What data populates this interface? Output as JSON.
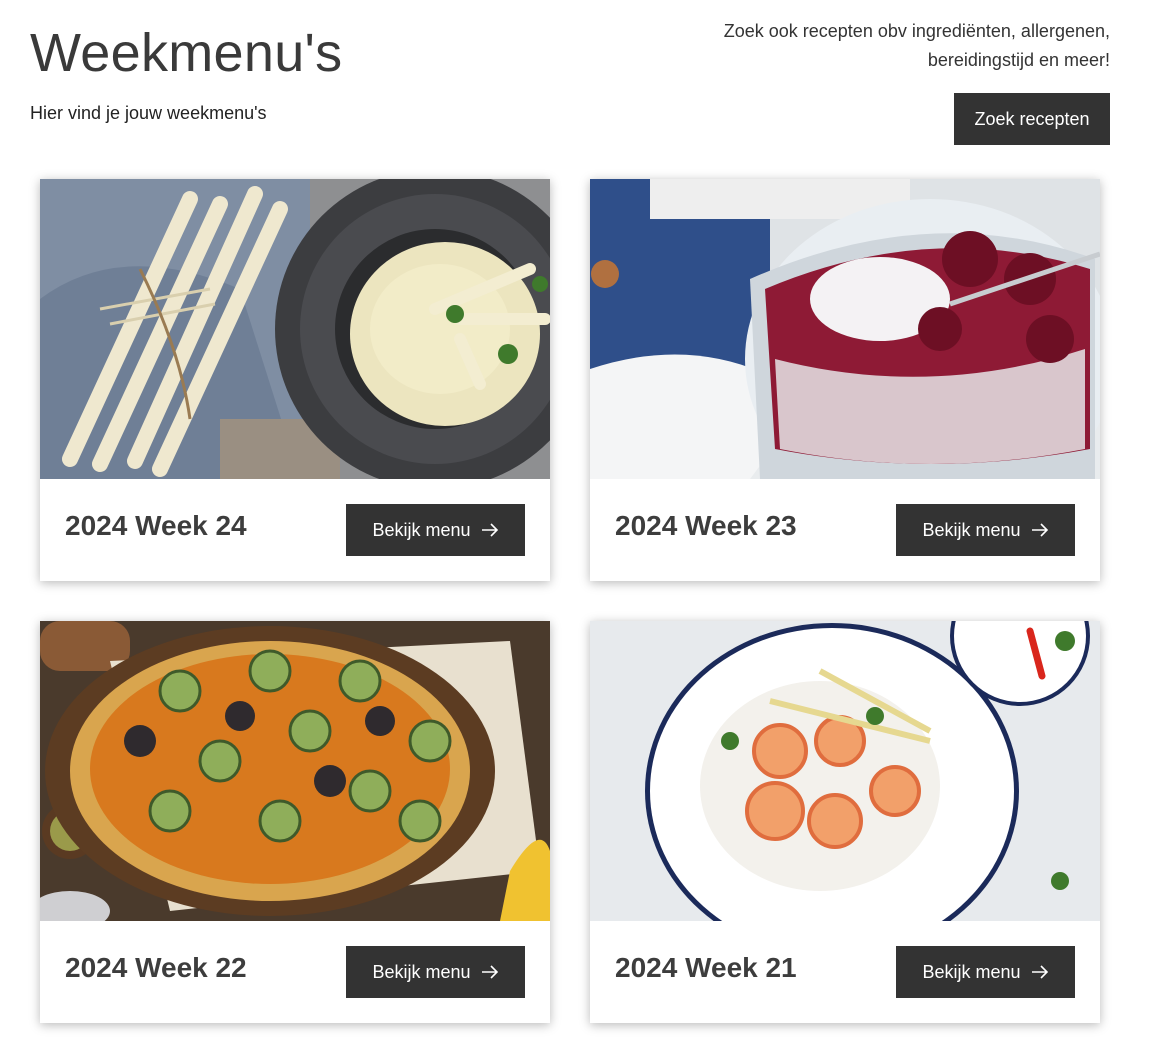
{
  "header": {
    "title": "Weekmenu's",
    "subtitle": "Hier vind je jouw weekmenu's",
    "search_hint": "Zoek ook recepten obv ingrediënten, allergenen, bereidingstijd en meer!",
    "search_button": "Zoek recepten"
  },
  "cards": [
    {
      "title": "2024 Week 24",
      "button": "Bekijk menu",
      "image": "asparagus-soup-photo"
    },
    {
      "title": "2024 Week 23",
      "button": "Bekijk menu",
      "image": "berry-chia-pudding-photo"
    },
    {
      "title": "2024 Week 22",
      "button": "Bekijk menu",
      "image": "vegetable-tart-photo"
    },
    {
      "title": "2024 Week 21",
      "button": "Bekijk menu",
      "image": "shrimp-rice-photo"
    }
  ],
  "colors": {
    "button_bg": "#333333",
    "title_text": "#3a3a3a"
  }
}
